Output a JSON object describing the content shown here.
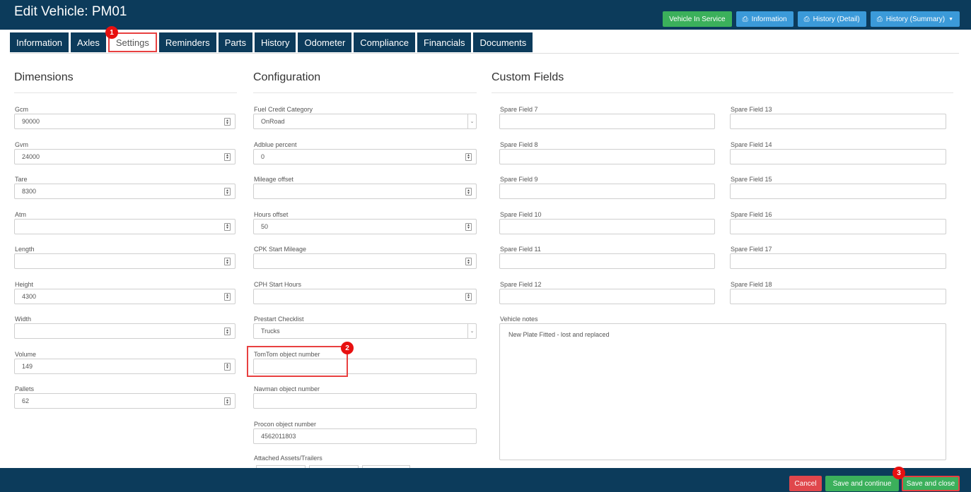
{
  "header": {
    "title": "Edit Vehicle: PM01",
    "buttons": {
      "in_service": "Vehicle In Service",
      "information": "Information",
      "history_detail": "History (Detail)",
      "history_summary": "History (Summary)"
    }
  },
  "tabs": [
    "Information",
    "Axles",
    "Settings",
    "Reminders",
    "Parts",
    "History",
    "Odometer",
    "Compliance",
    "Financials",
    "Documents"
  ],
  "active_tab": "Settings",
  "badges": [
    "1",
    "2",
    "3"
  ],
  "dimensions": {
    "title": "Dimensions",
    "fields": [
      {
        "label": "Gcm",
        "value": "90000"
      },
      {
        "label": "Gvm",
        "value": "24000"
      },
      {
        "label": "Tare",
        "value": "8300"
      },
      {
        "label": "Atm",
        "value": ""
      },
      {
        "label": "Length",
        "value": ""
      },
      {
        "label": "Height",
        "value": "4300"
      },
      {
        "label": "Width",
        "value": ""
      },
      {
        "label": "Volume",
        "value": "149"
      },
      {
        "label": "Pallets",
        "value": "62"
      }
    ]
  },
  "configuration": {
    "title": "Configuration",
    "fields": [
      {
        "label": "Fuel Credit Category",
        "value": "OnRoad"
      },
      {
        "label": "Adblue percent",
        "value": "0"
      },
      {
        "label": "Mileage offset",
        "value": ""
      },
      {
        "label": "Hours offset",
        "value": "50"
      },
      {
        "label": "CPK Start Mileage",
        "value": ""
      },
      {
        "label": "CPH Start Hours",
        "value": ""
      },
      {
        "label": "Prestart Checklist",
        "value": "Trucks"
      },
      {
        "label": "TomTom object number",
        "value": ""
      },
      {
        "label": "Navman object number",
        "value": ""
      },
      {
        "label": "Procon object number",
        "value": "4562011803"
      },
      {
        "label": "Attached Assets/Trailers",
        "value": ""
      }
    ]
  },
  "custom_fields": {
    "title": "Custom Fields",
    "left": [
      "Spare Field 7",
      "Spare Field 8",
      "Spare Field 9",
      "Spare Field 10",
      "Spare Field 11",
      "Spare Field 12"
    ],
    "right": [
      "Spare Field 13",
      "Spare Field 14",
      "Spare Field 15",
      "Spare Field 16",
      "Spare Field 17",
      "Spare Field 18"
    ],
    "notes_label": "Vehicle notes",
    "notes_value": "New Plate Fitted - lost and replaced"
  },
  "footer": {
    "cancel": "Cancel",
    "save_continue": "Save and continue",
    "save_close": "Save and close"
  },
  "icons": {
    "print": "printer-icon",
    "caret": "caret-down-icon",
    "spinner": "spinner-arrows-icon",
    "select": "select-arrow-icon"
  }
}
